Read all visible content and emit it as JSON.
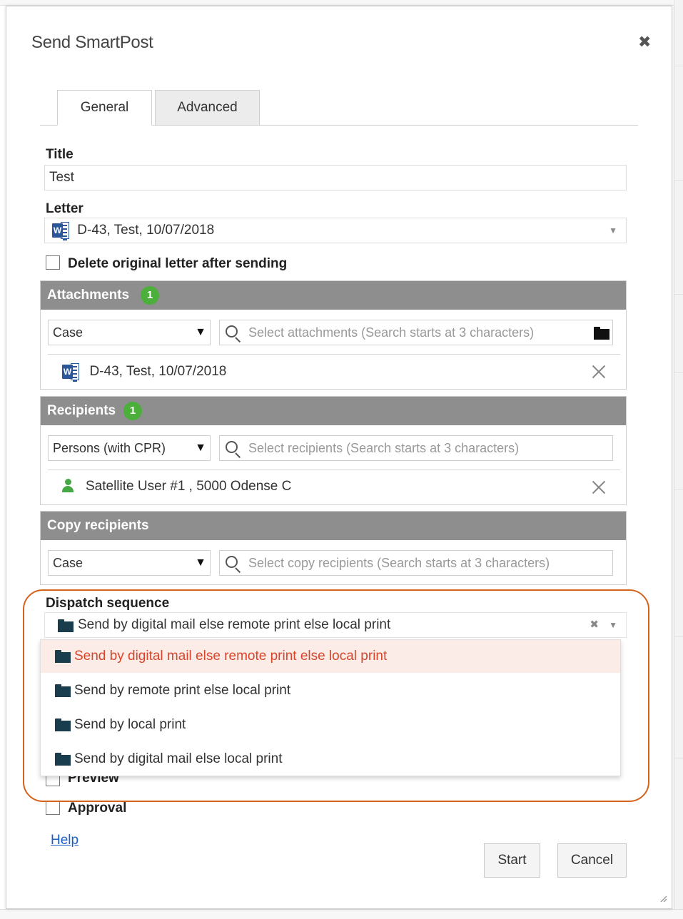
{
  "dialog": {
    "title": "Send SmartPost",
    "close_glyph": "✖"
  },
  "tabs": [
    {
      "label": "General",
      "active": true
    },
    {
      "label": "Advanced",
      "active": false
    }
  ],
  "form": {
    "title_label": "Title",
    "title_value": "Test",
    "letter_label": "Letter",
    "letter_value": "D-43, Test, 10/07/2018",
    "letter_icon": "word-document-icon",
    "delete_original_label": "Delete original letter after sending",
    "delete_original_checked": false
  },
  "attachments": {
    "header": "Attachments",
    "count": "1",
    "scope_value": "Case",
    "search_placeholder": "Select attachments (Search starts at 3 characters)",
    "items": [
      {
        "text": "D-43, Test, 10/07/2018",
        "icon": "word-document-icon"
      }
    ]
  },
  "recipients": {
    "header": "Recipients",
    "count": "1",
    "scope_value": "Persons (with CPR)",
    "search_placeholder": "Select recipients (Search starts at 3 characters)",
    "items": [
      {
        "text": "Satellite User #1 , 5000 Odense C",
        "icon": "person-icon"
      }
    ]
  },
  "copy_recipients": {
    "header": "Copy recipients",
    "scope_value": "Case",
    "search_placeholder": "Select copy recipients (Search starts at 3 characters)"
  },
  "dispatch": {
    "label": "Dispatch sequence",
    "selected": "Send by digital mail else remote print else local print",
    "clear_glyph": "✖",
    "options": [
      "Send by digital mail else remote print else local print",
      "Send by remote print else local print",
      "Send by local print",
      "Send by digital mail else local print"
    ],
    "highlighted_index": 0
  },
  "options_checkboxes": {
    "preview_label": "Preview",
    "approval_label": "Approval"
  },
  "footer": {
    "help_label": "Help",
    "start_label": "Start",
    "cancel_label": "Cancel"
  },
  "colors": {
    "section_header": "#8e8e8e",
    "badge": "#4caf3c",
    "highlight_option_text": "#d9452b",
    "annotation_outline": "#d4621c",
    "link": "#1a5fc8"
  }
}
